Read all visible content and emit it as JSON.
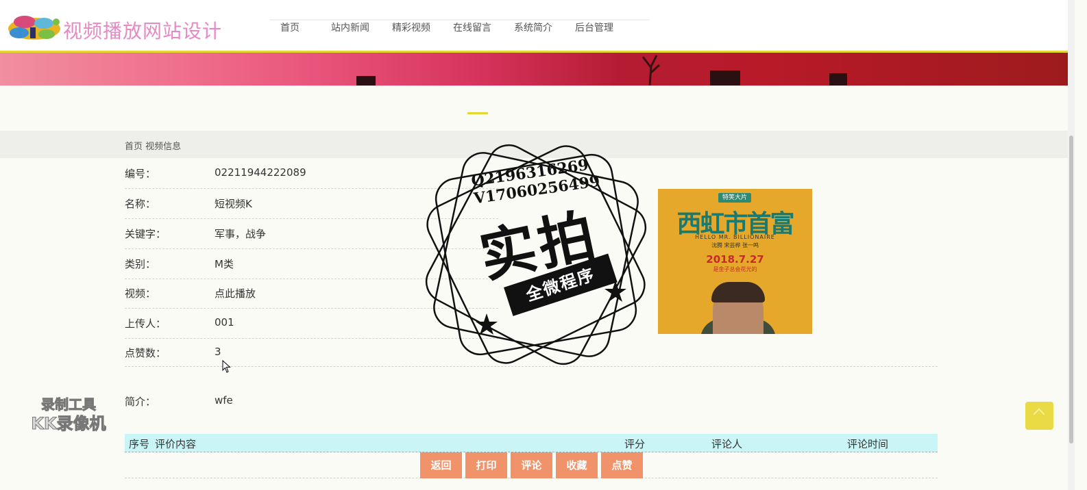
{
  "header": {
    "site_title": "视频播放网站设计",
    "nav": [
      "首页",
      "站内新闻",
      "精彩视频",
      "在线留言",
      "系统简介",
      "后台管理"
    ]
  },
  "breadcrumb": {
    "home": "首页",
    "current": "视频信息"
  },
  "info": [
    {
      "label": "编号：",
      "value": "02211944222089"
    },
    {
      "label": "名称：",
      "value": "短视频K"
    },
    {
      "label": "关键字：",
      "value": "军事，战争"
    },
    {
      "label": "类别：",
      "value": "M类"
    },
    {
      "label": "视频：",
      "value": "点此播放"
    },
    {
      "label": "上传人：",
      "value": "001"
    },
    {
      "label": "点赞数：",
      "value": "3"
    }
  ],
  "intro": {
    "label": "简介：",
    "value": "wfe"
  },
  "poster": {
    "tag": "特笑大片",
    "title": "西虹市首富",
    "english": "HELLO MR. BILLIONAIRE",
    "cast": "沈腾  宋芸桦  张一鸣",
    "date": "2018.7.27",
    "subtitle": "是金子总会花光的"
  },
  "comments": {
    "headers": [
      "序号",
      "评价内容",
      "评分",
      "评论人",
      "评论时间"
    ]
  },
  "buttons": [
    "返回",
    "打印",
    "评论",
    "收藏",
    "点赞"
  ],
  "stamp": {
    "contact_q": "Q2196316269",
    "contact_v": "V17060256499",
    "big_text": "实拍",
    "ribbon": "全微程序"
  },
  "recorder": {
    "line1": "录制工具",
    "line2": "KK录像机"
  },
  "colors": {
    "accent": "#e5d631",
    "title_pink": "#e58ac4",
    "button": "#f0936a",
    "table_head": "#c9f5f7"
  }
}
